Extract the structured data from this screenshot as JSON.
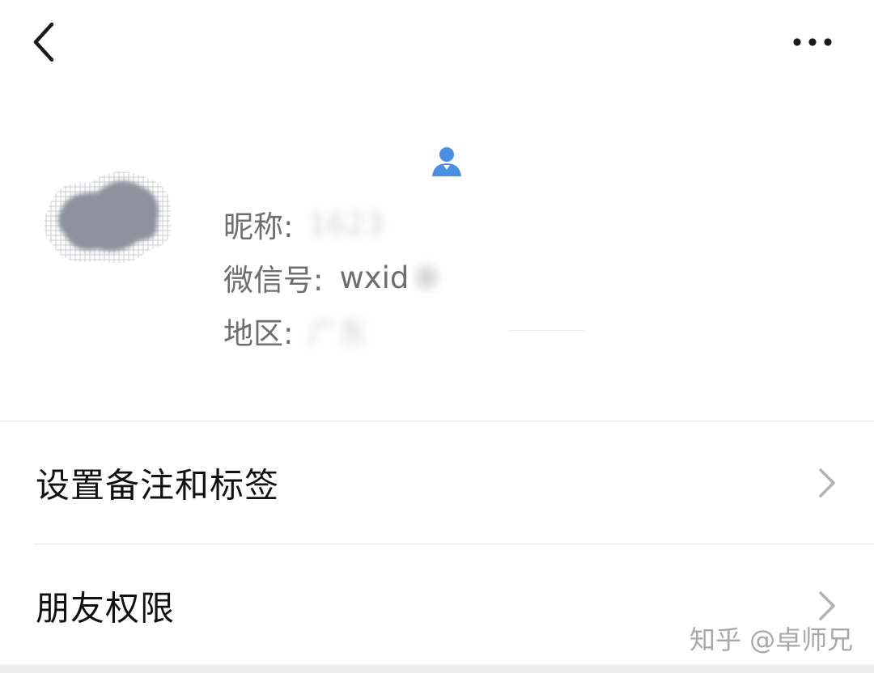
{
  "top_bar": {
    "back_icon": "chevron-left-icon",
    "more_icon": "more-horizontal-icon"
  },
  "profile": {
    "avatar_icon": "avatar-image",
    "contact_icon": "person-icon",
    "contact_icon_color": "#4a90e2",
    "nickname_label": "昵称:",
    "nickname_value": "1623",
    "wechat_label": "微信号:",
    "wechat_value": "wxid",
    "region_label": "地区:",
    "region_value": "广东"
  },
  "menu": {
    "items": [
      {
        "label": "设置备注和标签",
        "icon": "chevron-right-icon"
      },
      {
        "label": "朋友权限",
        "icon": "chevron-right-icon"
      }
    ]
  },
  "watermark": {
    "text": "知乎 @卓师兄"
  }
}
